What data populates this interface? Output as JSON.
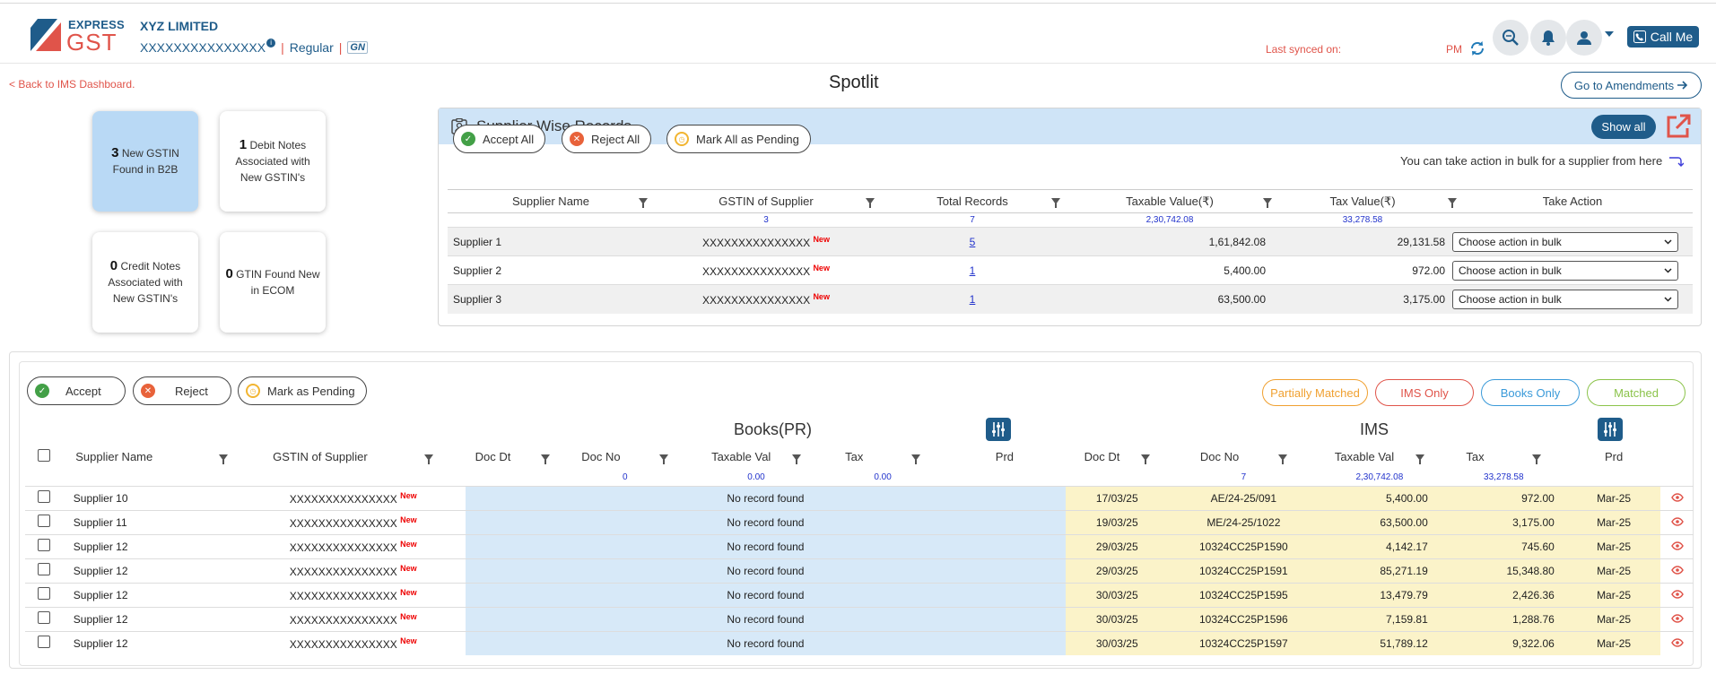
{
  "header": {
    "logo_top": "EXPRESS",
    "logo_bottom": "GST",
    "company": "XYZ LIMITED",
    "gstin": "XXXXXXXXXXXXXXX",
    "separator": "|",
    "taxpayer_type": "Regular",
    "gn_badge": "GN",
    "last_synced_label": "Last synced on:",
    "last_synced_suffix": "PM",
    "call_me": "Call Me"
  },
  "nav": {
    "back": "< Back to IMS Dashboard.",
    "title": "Spotlit",
    "go_to_amendments": "Go to Amendments"
  },
  "cards": [
    {
      "count": "3",
      "text": "New GSTIN Found in B2B"
    },
    {
      "count": "1",
      "text": "Debit Notes Associated with New GSTIN's"
    },
    {
      "count": "0",
      "text": "Credit Notes Associated with New GSTIN's"
    },
    {
      "count": "0",
      "text": "GTIN Found New in ECOM"
    }
  ],
  "supplier_wise": {
    "title": "Supplier Wise Records",
    "show_all": "Show all",
    "accept_all": "Accept All",
    "reject_all": "Reject All",
    "mark_all_pending": "Mark All as Pending",
    "bulk_hint": "You can take action in bulk for a supplier from here",
    "columns": [
      "Supplier Name",
      "GSTIN of Supplier",
      "Total Records",
      "Taxable Value(₹)",
      "Tax Value(₹)",
      "Take Action"
    ],
    "totals": {
      "gstin": "3",
      "records": "7",
      "taxable": "2,30,742.08",
      "tax": "33,278.58"
    },
    "rows": [
      {
        "name": "Supplier 1",
        "gstin": "XXXXXXXXXXXXXXX",
        "new": "New",
        "records": "5",
        "taxable": "1,61,842.08",
        "tax": "29,131.58",
        "action": "Choose action in bulk"
      },
      {
        "name": "Supplier 2",
        "gstin": "XXXXXXXXXXXXXXX",
        "new": "New",
        "records": "1",
        "taxable": "5,400.00",
        "tax": "972.00",
        "action": "Choose action in bulk"
      },
      {
        "name": "Supplier 3",
        "gstin": "XXXXXXXXXXXXXXX",
        "new": "New",
        "records": "1",
        "taxable": "63,500.00",
        "tax": "3,175.00",
        "action": "Choose action in bulk"
      }
    ]
  },
  "main": {
    "accept": "Accept",
    "reject": "Reject",
    "mark_pending": "Mark as Pending",
    "filters": [
      {
        "label": "Partially Matched",
        "color": "#f0a030"
      },
      {
        "label": "IMS Only",
        "color": "#e0544a"
      },
      {
        "label": "Books Only",
        "color": "#3a9ad9"
      },
      {
        "label": "Matched",
        "color": "#8bc34a"
      }
    ],
    "books_title": "Books(PR)",
    "ims_title": "IMS",
    "columns": {
      "supplier": "Supplier Name",
      "gstin": "GSTIN of Supplier",
      "doc_dt": "Doc Dt",
      "doc_no": "Doc No",
      "taxable": "Taxable Val",
      "tax": "Tax",
      "prd": "Prd"
    },
    "books_totals": {
      "doc_no": "0",
      "taxable": "0.00",
      "tax": "0.00"
    },
    "ims_totals": {
      "doc_no": "7",
      "taxable": "2,30,742.08",
      "tax": "33,278.58"
    },
    "no_record": "No record found",
    "rows": [
      {
        "name": "Supplier 10",
        "gstin": "XXXXXXXXXXXXXXX",
        "new": "New",
        "doc_dt": "17/03/25",
        "doc_no": "AE/24-25/091",
        "taxable": "5,400.00",
        "tax": "972.00",
        "prd": "Mar-25"
      },
      {
        "name": "Supplier 11",
        "gstin": "XXXXXXXXXXXXXXX",
        "new": "New",
        "doc_dt": "19/03/25",
        "doc_no": "ME/24-25/1022",
        "taxable": "63,500.00",
        "tax": "3,175.00",
        "prd": "Mar-25"
      },
      {
        "name": "Supplier 12",
        "gstin": "XXXXXXXXXXXXXXX",
        "new": "New",
        "doc_dt": "29/03/25",
        "doc_no": "10324CC25P1590",
        "taxable": "4,142.17",
        "tax": "745.60",
        "prd": "Mar-25"
      },
      {
        "name": "Supplier 12",
        "gstin": "XXXXXXXXXXXXXXX",
        "new": "New",
        "doc_dt": "29/03/25",
        "doc_no": "10324CC25P1591",
        "taxable": "85,271.19",
        "tax": "15,348.80",
        "prd": "Mar-25"
      },
      {
        "name": "Supplier 12",
        "gstin": "XXXXXXXXXXXXXXX",
        "new": "New",
        "doc_dt": "30/03/25",
        "doc_no": "10324CC25P1595",
        "taxable": "13,479.79",
        "tax": "2,426.36",
        "prd": "Mar-25"
      },
      {
        "name": "Supplier 12",
        "gstin": "XXXXXXXXXXXXXXX",
        "new": "New",
        "doc_dt": "30/03/25",
        "doc_no": "10324CC25P1596",
        "taxable": "7,159.81",
        "tax": "1,288.76",
        "prd": "Mar-25"
      },
      {
        "name": "Supplier 12",
        "gstin": "XXXXXXXXXXXXXXX",
        "new": "New",
        "doc_dt": "30/03/25",
        "doc_no": "10324CC25P1597",
        "taxable": "51,789.12",
        "tax": "9,322.06",
        "prd": "Mar-25"
      }
    ]
  }
}
